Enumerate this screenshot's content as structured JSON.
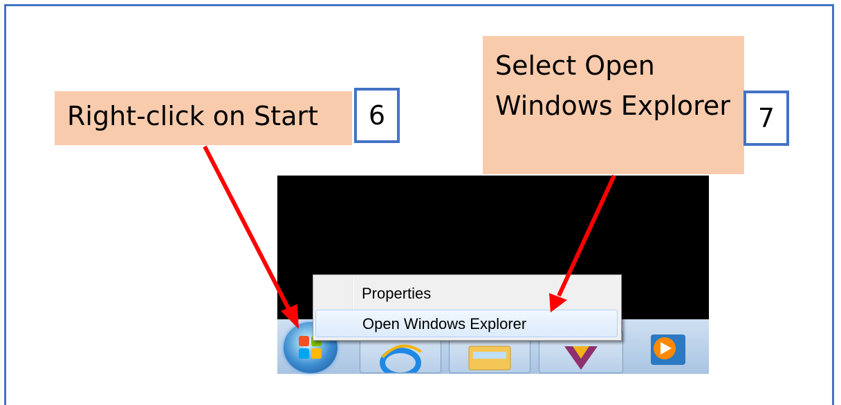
{
  "callouts": {
    "step6": {
      "text": "Right-click on Start",
      "number": "6"
    },
    "step7": {
      "text": "Select Open Windows Explorer",
      "number": "7"
    }
  },
  "context_menu": {
    "items": [
      {
        "label": "Properties"
      },
      {
        "label": "Open Windows Explorer",
        "highlighted": true
      }
    ]
  },
  "taskbar": {
    "buttons": [
      "start-orb",
      "internet-explorer",
      "windows-explorer",
      "pinned-app",
      "media-player"
    ]
  },
  "colors": {
    "callout_fill": "#f8cbad",
    "step_border": "#4472c4",
    "arrow": "#ff0000",
    "frame_border": "#4472c4"
  }
}
